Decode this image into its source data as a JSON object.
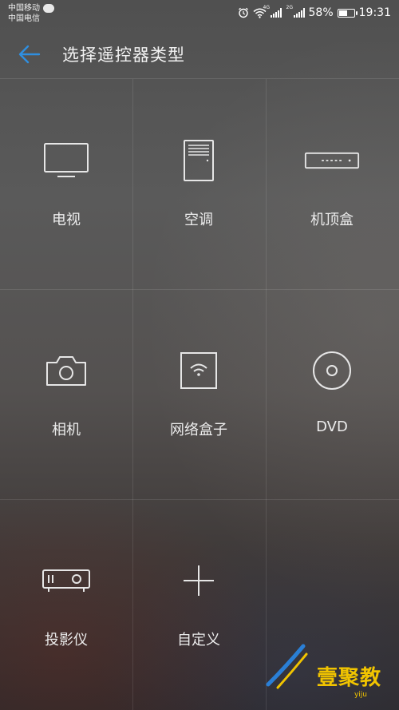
{
  "status_bar": {
    "carrier1": "中国移动",
    "carrier2": "中国电信",
    "sim1_tag": "4G",
    "sim2_tag": "2G",
    "battery": "58%",
    "time": "19:31"
  },
  "header": {
    "title": "选择遥控器类型"
  },
  "devices": [
    {
      "label": "电视",
      "icon": "tv-icon"
    },
    {
      "label": "空调",
      "icon": "air-conditioner-icon"
    },
    {
      "label": "机顶盒",
      "icon": "set-top-box-icon"
    },
    {
      "label": "相机",
      "icon": "camera-icon"
    },
    {
      "label": "网络盒子",
      "icon": "network-box-icon"
    },
    {
      "label": "DVD",
      "icon": "dvd-icon"
    },
    {
      "label": "投影仪",
      "icon": "projector-icon"
    },
    {
      "label": "自定义",
      "icon": "plus-icon"
    }
  ],
  "watermark": {
    "text": "壹聚教",
    "sub": "yiju"
  },
  "colors": {
    "accent": "#2f8fe0",
    "watermark": "#f1c400"
  }
}
